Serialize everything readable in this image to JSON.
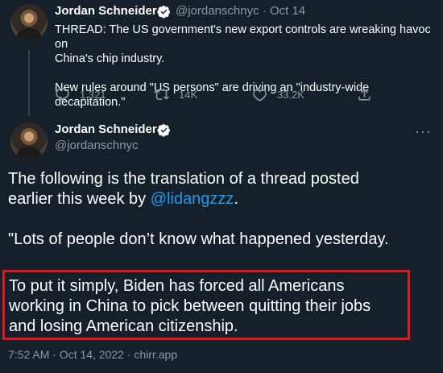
{
  "tweet1": {
    "name": "Jordan Schneider",
    "handle": "@jordanschnyc",
    "dot": "·",
    "date": "Oct 14",
    "line1": "THREAD: The US government's new export controls are wreaking havoc on",
    "line2": "China's chip industry.",
    "line3": "New rules around \"US persons\" are driving an \"industry-wide decapitation.\"",
    "replies": "1,321",
    "retweets": "14K",
    "likes": "33.2K"
  },
  "tweet2": {
    "name": "Jordan Schneider",
    "handle": "@jordanschnyc",
    "more": "···",
    "para1_line1": "The following is the translation of a thread posted",
    "para1_line2_prefix": "earlier this week by ",
    "para1_link": "@lidangzzz",
    "para1_suffix": ".",
    "para2": "\"Lots of people don’t know what happened yesterday.",
    "highlight_line1": "To put it simply, Biden has forced all Americans",
    "highlight_line2": "working in China to pick between quitting their jobs",
    "highlight_line3": "and losing American citizenship.",
    "meta": "7:52 AM · Oct 14, 2022 · chirr.app"
  },
  "colors": {
    "background": "#15202b",
    "link": "#1d9bf0",
    "muted": "#8b98a5",
    "highlight_border": "#e3171b"
  }
}
